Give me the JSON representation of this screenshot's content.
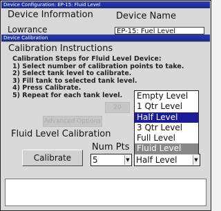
{
  "background_window": {
    "title": "Device Configuration: EP-15: Fluid Level",
    "device_info_label": "Device Information",
    "device_name_label": "Device Name",
    "manufacturer_value": "Lowrance",
    "device_name_value": "EP-15: Fuel Level"
  },
  "dialog": {
    "title": "Device Calibration",
    "instructions_heading": "Calibration Instructions",
    "steps": [
      "Calibration Steps for Fluid Level Device:",
      "1) Select number of calibration points to take.",
      "2) Select tank level to calibrate.",
      "3) Fill tank to selected tank level.",
      "4) Press Calibrate.",
      "5) Repeat for each tank level."
    ],
    "level_options": [
      "Empty Level",
      "1 Qtr Level",
      "Half Level",
      "3 Qtr Level",
      "Full Level",
      "Fluid Level"
    ],
    "highlighted_option": "Half Level",
    "current_option": "Fluid Level",
    "calibration_section_label": "Fluid Level Calibration",
    "num_pts_label": "Num Pts",
    "calibrate_button": "Calibrate",
    "num_pts_value": "5",
    "level_select_value": "Half Level"
  },
  "background_ghost_labels": [
    "20",
    "Advanced Options"
  ],
  "colors": {
    "titlebar": "#1a2a8a",
    "selection": "#1b1b99",
    "current_item": "#888888",
    "dialog_bg": "#d9d9d9"
  }
}
